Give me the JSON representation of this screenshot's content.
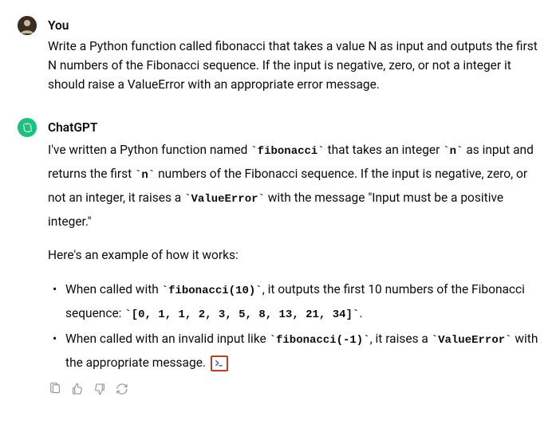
{
  "user": {
    "author": "You",
    "message": "Write a Python function called fibonacci that takes a value N as input and outputs the first N numbers of the Fibonacci sequence. If the input is negative, zero, or not a integer it should raise a ValueError with an appropriate error message."
  },
  "assistant": {
    "author": "ChatGPT",
    "p1": {
      "t1": "I've written a Python function named ",
      "c1": "`fibonacci`",
      "t2": " that takes an integer ",
      "c2": "`n`",
      "t3": " as input and returns the first ",
      "c3": "`n`",
      "t4": " numbers of the Fibonacci sequence. If the input is negative, zero, or not an integer, it raises a ",
      "c4": "`ValueError`",
      "t5": " with the message \"Input must be a positive integer.\""
    },
    "p2": "Here's an example of how it works:",
    "bullets": [
      {
        "t1": "When called with ",
        "c1": "`fibonacci(10)`",
        "t2": ", it outputs the first 10 numbers of the Fibonacci sequence: ",
        "c2": "`[0, 1, 1, 2, 3, 5, 8, 13, 21, 34]`",
        "t3": "."
      },
      {
        "t1": "When called with an invalid input like ",
        "c1": "`fibonacci(-1)`",
        "t2": ", it raises a ",
        "c2": "`ValueError`",
        "t3": " with the appropriate message. "
      }
    ]
  },
  "icons": {
    "code_link": "terminal-icon",
    "copy": "clipboard-icon",
    "like": "thumbs-up-icon",
    "dislike": "thumbs-down-icon",
    "regen": "refresh-icon"
  }
}
